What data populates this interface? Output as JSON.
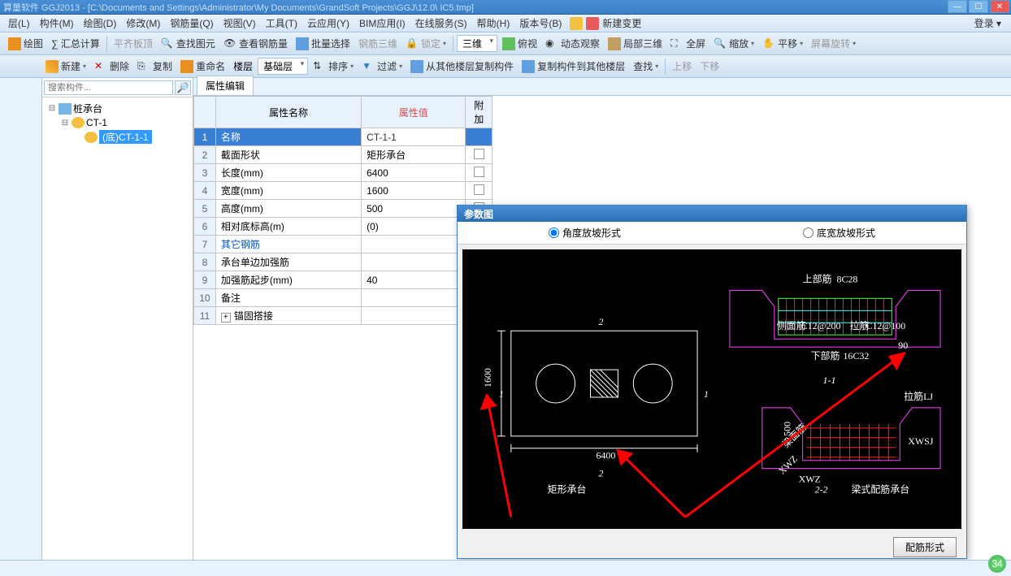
{
  "title": "算量软件 GGJ2013 - [C:\\Documents and Settings\\Administrator\\My Documents\\GrandSoft Projects\\GGJ\\12.0\\ IC5.tmp]",
  "menu": [
    "层(L)",
    "构件(M)",
    "绘图(D)",
    "修改(M)",
    "钢筋量(Q)",
    "视图(V)",
    "工具(T)",
    "云应用(Y)",
    "BIM应用(I)",
    "在线服务(S)",
    "帮助(H)",
    "版本号(B)"
  ],
  "login": "登录 ▾",
  "toolbar1": {
    "huitu": "绘图",
    "sigma": "∑ 汇总计算",
    "ping": "平齐板顶",
    "chazhao": "查找图元",
    "chakan": "查看钢筋量",
    "piliang": "批量选择",
    "rebar": "钢筋三维",
    "lock": "锁定",
    "sanwei": "三维",
    "fushi": "俯视",
    "dongtai": "动态观察",
    "jubu": "局部三维",
    "quanping": "全屏",
    "suofang": "缩放",
    "pingyi": "平移",
    "pingmu": "屏幕旋转"
  },
  "toolbar2": {
    "xinjian": "新建",
    "shanchu": "删除",
    "fuzhi": "复制",
    "chongmingming": "重命名",
    "louceng": "楼层",
    "jichu": "基础层",
    "paixu": "排序",
    "guolv": "过滤",
    "conglou": "从其他楼层复制构件",
    "fuzhidao": "复制构件到其他楼层",
    "chazhao": "查找",
    "shangyi": "上移",
    "xiayi": "下移"
  },
  "search_placeholder": "搜索构件...",
  "tree": {
    "root": "桩承台",
    "l2": "CT-1",
    "l3": "(底)CT-1-1"
  },
  "tab_prop": "属性编辑",
  "prop_headers": {
    "name": "属性名称",
    "value": "属性值",
    "attach": "附加"
  },
  "rows": [
    {
      "n": "1",
      "name": "名称",
      "value": "CT-1-1",
      "sel": true
    },
    {
      "n": "2",
      "name": "截面形状",
      "value": "矩形承台",
      "chk": true
    },
    {
      "n": "3",
      "name": "长度(mm)",
      "value": "6400",
      "chk": true
    },
    {
      "n": "4",
      "name": "宽度(mm)",
      "value": "1600",
      "chk": true
    },
    {
      "n": "5",
      "name": "高度(mm)",
      "value": "500",
      "chk": true
    },
    {
      "n": "6",
      "name": "相对底标高(m)",
      "value": "(0)",
      "chk": true
    },
    {
      "n": "7",
      "name": "其它钢筋",
      "value": "",
      "link": true
    },
    {
      "n": "8",
      "name": "承台单边加强筋",
      "value": ""
    },
    {
      "n": "9",
      "name": "加强筋起步(mm)",
      "value": "40"
    },
    {
      "n": "10",
      "name": "备注",
      "value": "",
      "chk": true
    },
    {
      "n": "11",
      "name": "锚固搭接",
      "value": "",
      "expand": true
    }
  ],
  "dialog": {
    "title": "参数图",
    "radio1": "角度放坡形式",
    "radio2": "底宽放坡形式",
    "button": "配筋形式",
    "labels": {
      "juxing": "矩形承台",
      "liangshi": "梁式配筋承台",
      "shangbu": "上部筋",
      "shangbu_v": "8C28",
      "cemian": "侧面筋",
      "cemian_v": "C12@200",
      "xiabu": "下部筋",
      "xiabu_v": "16C32",
      "lajin": "拉筋",
      "lajin_v": "C12@100",
      "liangmian": "梁面筋",
      "lajin2": "拉筋LJ",
      "xwsj": "XWSJ",
      "xwz": "XWZ",
      "sec11": "1-1",
      "sec22": "2-2",
      "s1": "1",
      "s1b": "1",
      "s2": "2",
      "s2b": "2",
      "d6400": "6400",
      "d1600": "1600",
      "a90": "90",
      "a500": "500"
    }
  },
  "badge": "34"
}
